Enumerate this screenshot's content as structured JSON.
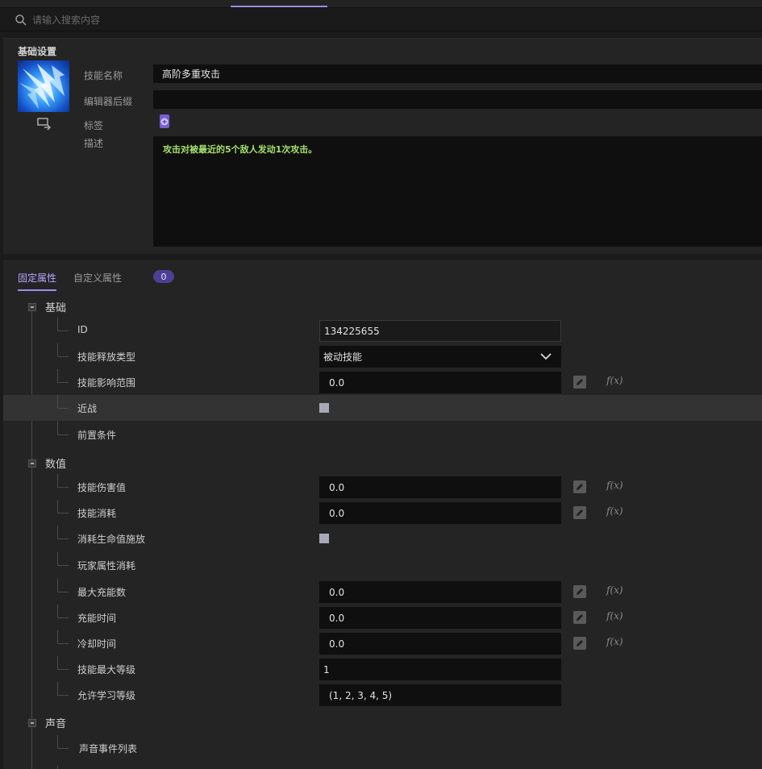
{
  "search": {
    "placeholder": "请输入搜索内容"
  },
  "basic": {
    "title": "基础设置",
    "fields": {
      "name_label": "技能名称",
      "name_value": "高阶多重攻击",
      "suffix_label": "编辑器后缀",
      "suffix_value": "",
      "tags_label": "标签",
      "desc_label": "描述",
      "desc_value": "攻击对被最近的5个敌人发动1次攻击。"
    }
  },
  "props": {
    "tabs": [
      {
        "label": "固定属性",
        "active": true
      },
      {
        "label": "自定义属性",
        "active": false
      }
    ],
    "custom_count": "0",
    "groups": {
      "base": {
        "label": "基础",
        "rows": {
          "id": {
            "label": "ID",
            "value": "134225655"
          },
          "cast_type": {
            "label": "技能释放类型",
            "value": "被动技能"
          },
          "range": {
            "label": "技能影响范围",
            "value": "0.0"
          },
          "melee": {
            "label": "近战",
            "checked": false
          },
          "precondition": {
            "label": "前置条件"
          }
        }
      },
      "numeric": {
        "label": "数值",
        "rows": {
          "damage": {
            "label": "技能伤害值",
            "value": "0.0"
          },
          "cost": {
            "label": "技能消耗",
            "value": "0.0"
          },
          "hp_cast": {
            "label": "消耗生命值施放",
            "checked": false
          },
          "player_attr_cost": {
            "label": "玩家属性消耗"
          },
          "max_charges": {
            "label": "最大充能数",
            "value": "0.0"
          },
          "charge_time": {
            "label": "充能时间",
            "value": "0.0"
          },
          "cooldown": {
            "label": "冷却时间",
            "value": "0.0"
          },
          "max_level": {
            "label": "技能最大等级",
            "value": "1"
          },
          "learn_levels": {
            "label": "允许学习等级",
            "value": "(1, 2, 3, 4, 5)"
          }
        }
      },
      "sound": {
        "label": "声音",
        "rows": {
          "events": {
            "label": "声音事件列表"
          }
        }
      }
    },
    "fx_label": "f(x)"
  },
  "colors": {
    "accent": "#9a8cf0",
    "desc_text": "#a4e06a",
    "badge": "#4d3f93"
  }
}
